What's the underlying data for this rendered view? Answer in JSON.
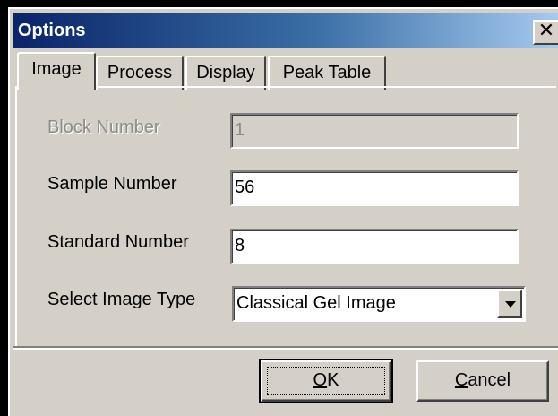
{
  "window": {
    "title": "Options",
    "close_glyph": "✕"
  },
  "tabs": [
    {
      "label": "Image",
      "active": true
    },
    {
      "label": "Process",
      "active": false
    },
    {
      "label": "Display",
      "active": false
    },
    {
      "label": "Peak Table",
      "active": false
    }
  ],
  "fields": {
    "block_number": {
      "label": "Block Number",
      "value": "1",
      "disabled": true
    },
    "sample_number": {
      "label": "Sample Number",
      "value": "56"
    },
    "standard_number": {
      "label": "Standard Number",
      "value": "8"
    },
    "image_type": {
      "label": "Select Image Type",
      "value": "Classical Gel Image"
    }
  },
  "buttons": {
    "ok": {
      "mnemonic": "O",
      "rest": "K"
    },
    "cancel": {
      "mnemonic": "C",
      "rest": "ancel"
    }
  },
  "colors": {
    "face": "#d4d0c8",
    "title_start": "#0a246a",
    "title_end": "#a6caf0",
    "disabled_text": "#8c8c8c"
  },
  "icons": {
    "close": "close-icon",
    "dropdown": "chevron-down-icon"
  }
}
